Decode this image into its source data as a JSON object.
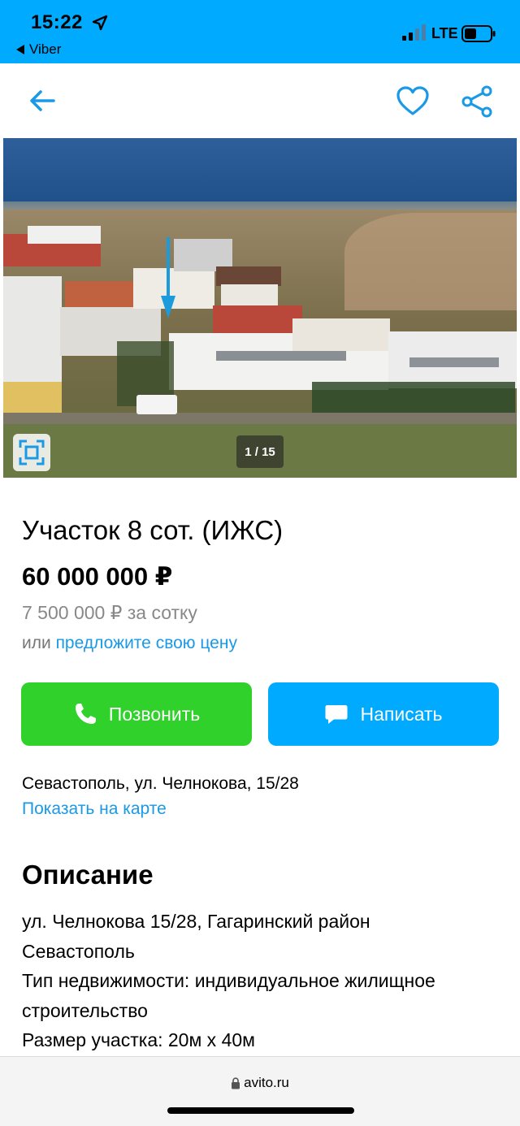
{
  "statusbar": {
    "time": "15:22",
    "back_app": "Viber",
    "network": "LTE",
    "background_color": "#00aaff"
  },
  "nav": {
    "back_icon": "arrow-left-icon",
    "favorite_icon": "heart-icon",
    "share_icon": "share-icon",
    "accent_color": "#1a99e6"
  },
  "gallery": {
    "counter": "1 / 15",
    "expand_icon": "fullscreen-icon"
  },
  "listing": {
    "title": "Участок 8 сот. (ИЖС)",
    "price": "60 000 000 ₽",
    "price_per_sotka": "7 500 000 ₽ за сотку",
    "offer_prefix": "или",
    "offer_link": "предложите свою цену"
  },
  "actions": {
    "call_label": "Позвонить",
    "call_icon": "phone-icon",
    "call_color": "#2fd12a",
    "message_label": "Написать",
    "message_icon": "chat-bubble-icon",
    "message_color": "#00aaff"
  },
  "location": {
    "address": "Севастополь, ул. Челнокова, 15/28",
    "map_link": "Показать на карте"
  },
  "description": {
    "heading": "Описание",
    "lines": [
      "ул. Челнокова 15/28, Гагаринский район",
      "Севастополь",
      "Тип недвижимости: индивидуальное жилищное",
      "строительство",
      "Размер участка: 20м х 40м"
    ]
  },
  "browser": {
    "url": "avito.ru",
    "lock_icon": "lock-icon"
  }
}
